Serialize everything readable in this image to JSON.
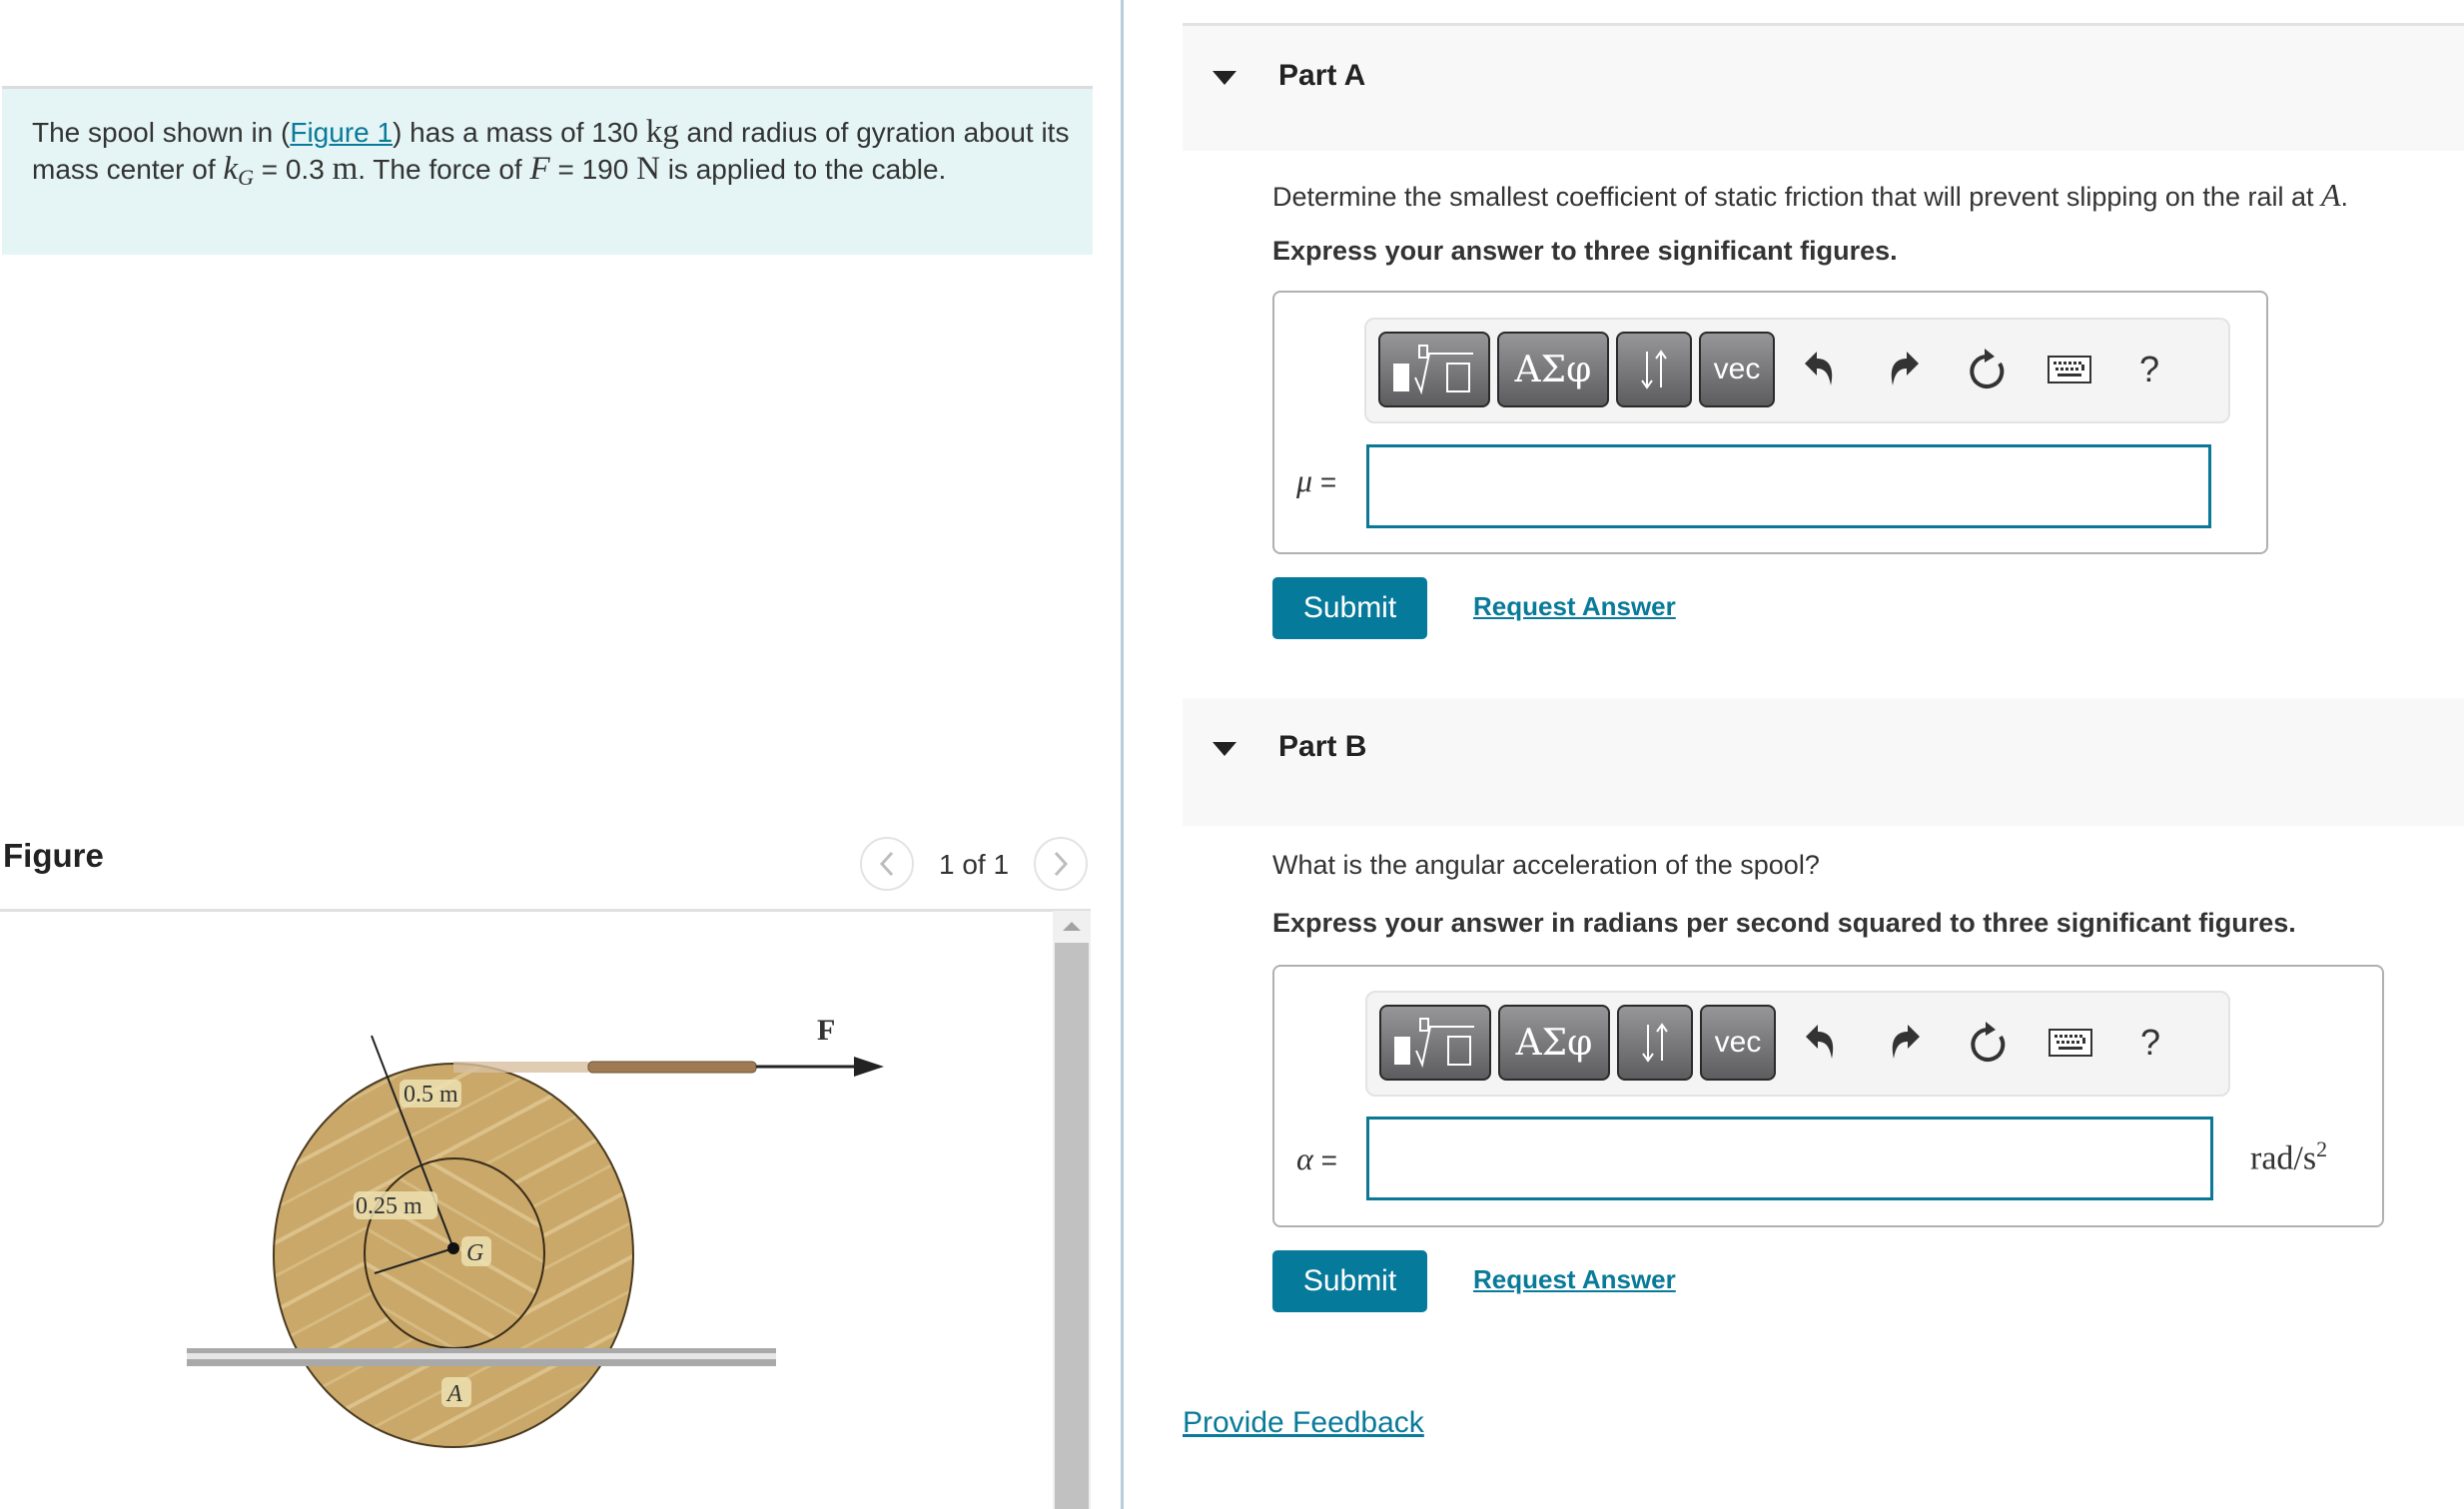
{
  "problem": {
    "text_1": "The spool shown in (",
    "figure_link": "Figure 1",
    "text_2": ") has a mass of 130 ",
    "unit_kg": "kg",
    "text_3": " and radius of gyration about its mass center of ",
    "k_symbol": "k",
    "k_sub": "G",
    "text_4": " = 0.3 ",
    "unit_m": "m",
    "text_5": ". The force of ",
    "f_symbol": "F",
    "text_6": " = 190 ",
    "unit_n": "N",
    "text_7": " is applied to the cable."
  },
  "figure": {
    "title": "Figure",
    "pager": "1 of 1",
    "prev_icon": "chevron-left-icon",
    "next_icon": "chevron-right-icon",
    "labels": {
      "outer_radius": "0.5 m",
      "inner_radius": "0.25 m",
      "center": "G",
      "contact_point": "A",
      "force": "F"
    },
    "colors": {
      "wood": "#c9a86a",
      "wood_light": "#d9bf85",
      "rail": "#b8b8b8"
    }
  },
  "parts": [
    {
      "title": "Part A",
      "question": "Determine the smallest coefficient of static friction that will prevent slipping on the rail at ",
      "question_var": "A",
      "question_end": ".",
      "instruction": "Express your answer to three significant figures.",
      "variable": "μ",
      "equals": "=",
      "value": "",
      "unit": "",
      "submit": "Submit",
      "request_answer": "Request Answer"
    },
    {
      "title": "Part B",
      "question": "What is the angular acceleration of the spool?",
      "instruction": "Express your answer in radians per second squared to three significant figures.",
      "variable": "α",
      "equals": "=",
      "value": "",
      "unit": "rad/s",
      "unit_exp": "2",
      "submit": "Submit",
      "request_answer": "Request Answer"
    }
  ],
  "toolbar": {
    "templates_label": "templates",
    "greek_label": "ΑΣφ",
    "arrows_label": "⇵",
    "vec_label": "vec",
    "undo_icon": "undo-icon",
    "redo_icon": "redo-icon",
    "reset_icon": "reset-icon",
    "keyboard_icon": "keyboard-icon",
    "help_label": "?"
  },
  "footer": {
    "feedback": "Provide Feedback"
  },
  "colors": {
    "accent": "#067a9b",
    "problem_bg": "#e5f5f6",
    "header_bg": "#f8f8f8"
  }
}
